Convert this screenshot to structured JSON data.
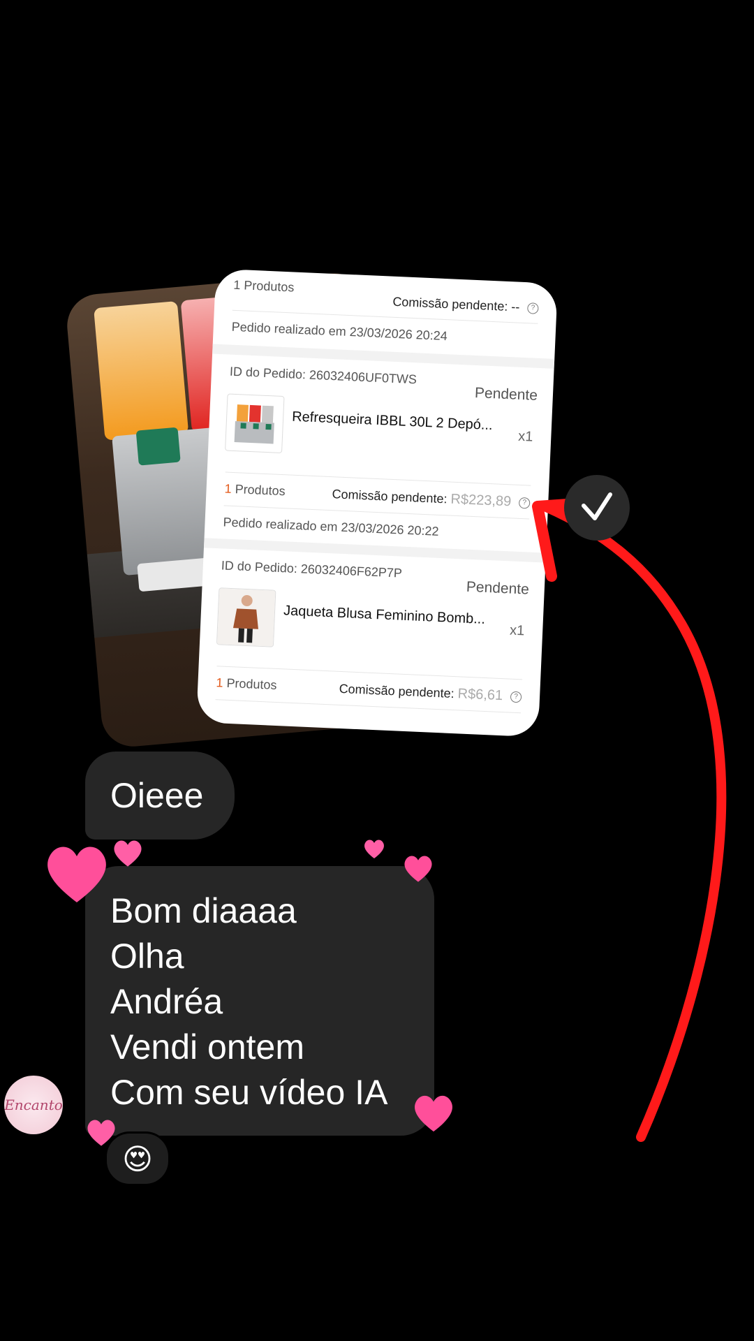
{
  "order_card": {
    "top_products": "1 Produtos",
    "top_commission_label": "Comissão pendente:",
    "top_commission_value": "--",
    "pedido_1": "Pedido realizado em 23/03/2026 20:24",
    "order1": {
      "id": "ID do Pedido: 26032406UF0TWS",
      "status": "Pendente",
      "title": "Refresqueira IBBL 30L 2 Depó...",
      "qty": "x1",
      "products_count": "1",
      "products_label": "Produtos",
      "commission_label": "Comissão pendente:",
      "commission_value": "R$223,89",
      "date": "Pedido realizado em 23/03/2026 20:22"
    },
    "order2": {
      "id": "ID do Pedido: 26032406F62P7P",
      "status": "Pendente",
      "title": "Jaqueta Blusa Feminino Bomb...",
      "qty": "x1",
      "products_count": "1",
      "products_label": "Produtos",
      "commission_label": "Comissão pendente:",
      "commission_value": "R$6,61"
    },
    "help_glyph": "?"
  },
  "messages": {
    "first": "Oieee",
    "second_lines": [
      "Bom diaaaa",
      "Olha",
      "Andréa",
      "Vendi ontem",
      "Com seu vídeo IA"
    ]
  },
  "avatar": {
    "text": "Encanto"
  },
  "reaction": {
    "emoji": "😍"
  },
  "colors": {
    "accent_red": "#ff1a1a",
    "bubble": "#262626",
    "heart_pink": "#ff4f9a",
    "orange": "#e35a1b"
  }
}
